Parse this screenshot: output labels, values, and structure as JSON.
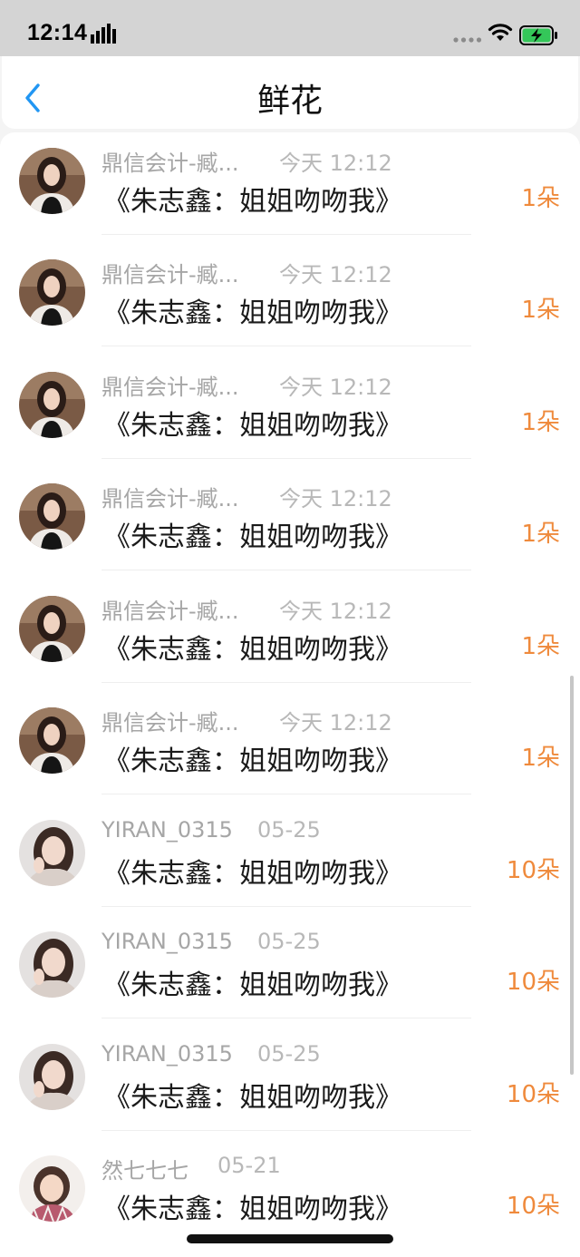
{
  "status_bar": {
    "time": "12:14",
    "icons": [
      "signal-bars-icon",
      "cellular-dots-icon",
      "wifi-icon",
      "battery-charging-icon"
    ]
  },
  "nav": {
    "title": "鲜花",
    "back_icon": "chevron-left-icon",
    "accent_color": "#2196f3"
  },
  "colors": {
    "count": "#ef8a3c",
    "name": "#a6a6a6",
    "message": "#1a1a1a"
  },
  "gifts": [
    {
      "name": "鼎信会计-臧...",
      "time": "今天 12:12",
      "message": "《朱志鑫：姐姐吻吻我》",
      "count": "1朵"
    },
    {
      "name": "鼎信会计-臧...",
      "time": "今天 12:12",
      "message": "《朱志鑫：姐姐吻吻我》",
      "count": "1朵"
    },
    {
      "name": "鼎信会计-臧...",
      "time": "今天 12:12",
      "message": "《朱志鑫：姐姐吻吻我》",
      "count": "1朵"
    },
    {
      "name": "鼎信会计-臧...",
      "time": "今天 12:12",
      "message": "《朱志鑫：姐姐吻吻我》",
      "count": "1朵"
    },
    {
      "name": "鼎信会计-臧...",
      "time": "今天 12:12",
      "message": "《朱志鑫：姐姐吻吻我》",
      "count": "1朵"
    },
    {
      "name": "鼎信会计-臧...",
      "time": "今天 12:12",
      "message": "《朱志鑫：姐姐吻吻我》",
      "count": "1朵"
    },
    {
      "name": "YIRAN_0315",
      "time": "05-25",
      "message": "《朱志鑫：姐姐吻吻我》",
      "count": "10朵"
    },
    {
      "name": "YIRAN_0315",
      "time": "05-25",
      "message": "《朱志鑫：姐姐吻吻我》",
      "count": "10朵"
    },
    {
      "name": "YIRAN_0315",
      "time": "05-25",
      "message": "《朱志鑫：姐姐吻吻我》",
      "count": "10朵"
    },
    {
      "name": "然七七七",
      "time": "05-21",
      "message": "《朱志鑫：姐姐吻吻我》",
      "count": "10朵"
    }
  ]
}
